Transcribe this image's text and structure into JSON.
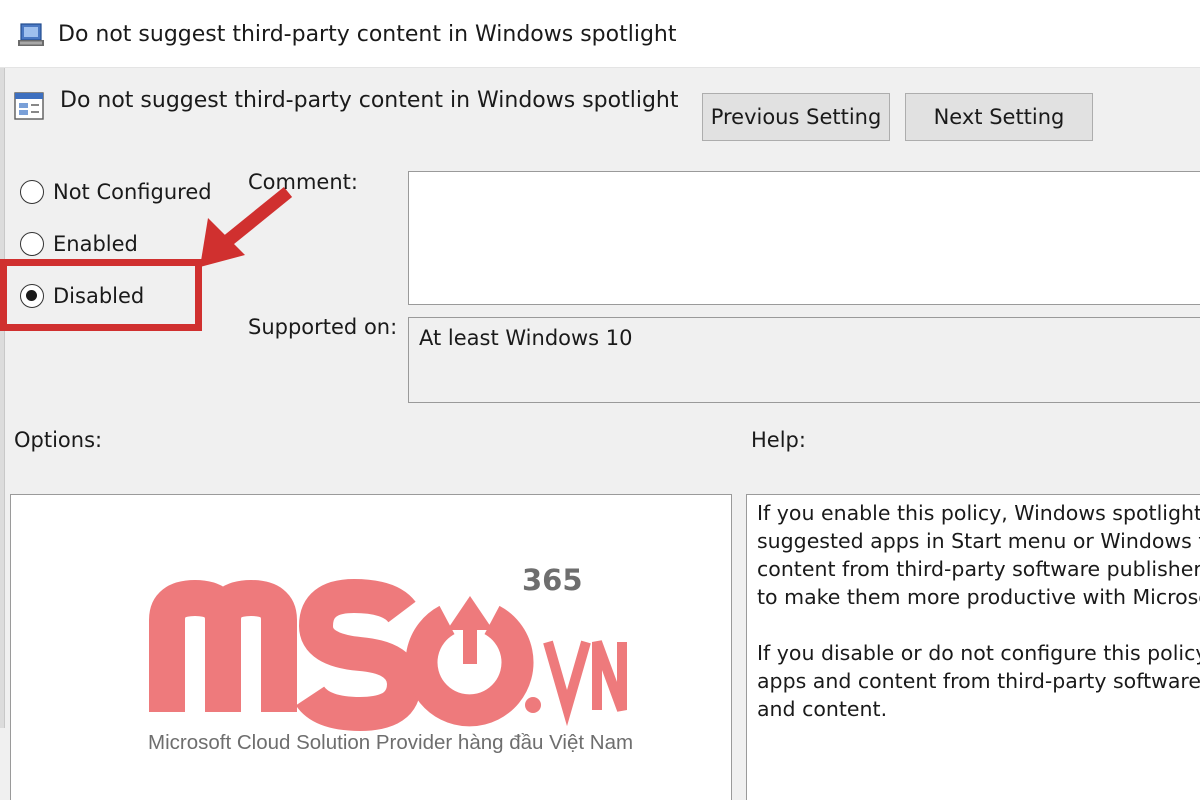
{
  "window": {
    "title": "Do not suggest third-party content in Windows spotlight"
  },
  "policy": {
    "name": "Do not suggest third-party content in Windows spotlight"
  },
  "buttons": {
    "previous": "Previous Setting",
    "next": "Next Setting"
  },
  "state_options": [
    {
      "label": "Not Configured",
      "checked": false
    },
    {
      "label": "Enabled",
      "checked": false
    },
    {
      "label": "Disabled",
      "checked": true
    }
  ],
  "labels": {
    "comment": "Comment:",
    "supported_on": "Supported on:",
    "options": "Options:",
    "help": "Help:"
  },
  "fields": {
    "comment_value": "",
    "supported_on_value": "At least Windows 10"
  },
  "help": {
    "paragraph1": "If you enable this policy, Windows spotlight fe\nsuggested apps in Start menu or Windows tip\ncontent from third-party software publishers.\nto make them more productive with Microsof",
    "paragraph2": "If you disable or do not configure this policy, \napps and content from third-party software p\nand content."
  },
  "watermark": {
    "brand_letters": "MSO",
    "suffix": ".VN",
    "superscript": "365",
    "tagline": "Microsoft Cloud Solution Provider hàng đầu Việt Nam"
  },
  "colors": {
    "annotation_red": "#d0302f",
    "watermark_pink": "#ee7a7c",
    "watermark_gray": "#6e6e6e",
    "dialog_bg": "#f0f0f0"
  },
  "icons": {
    "window_icon": "policy-editor-icon",
    "policy_icon": "setting-icon",
    "annotation": "red-arrow-icon"
  }
}
